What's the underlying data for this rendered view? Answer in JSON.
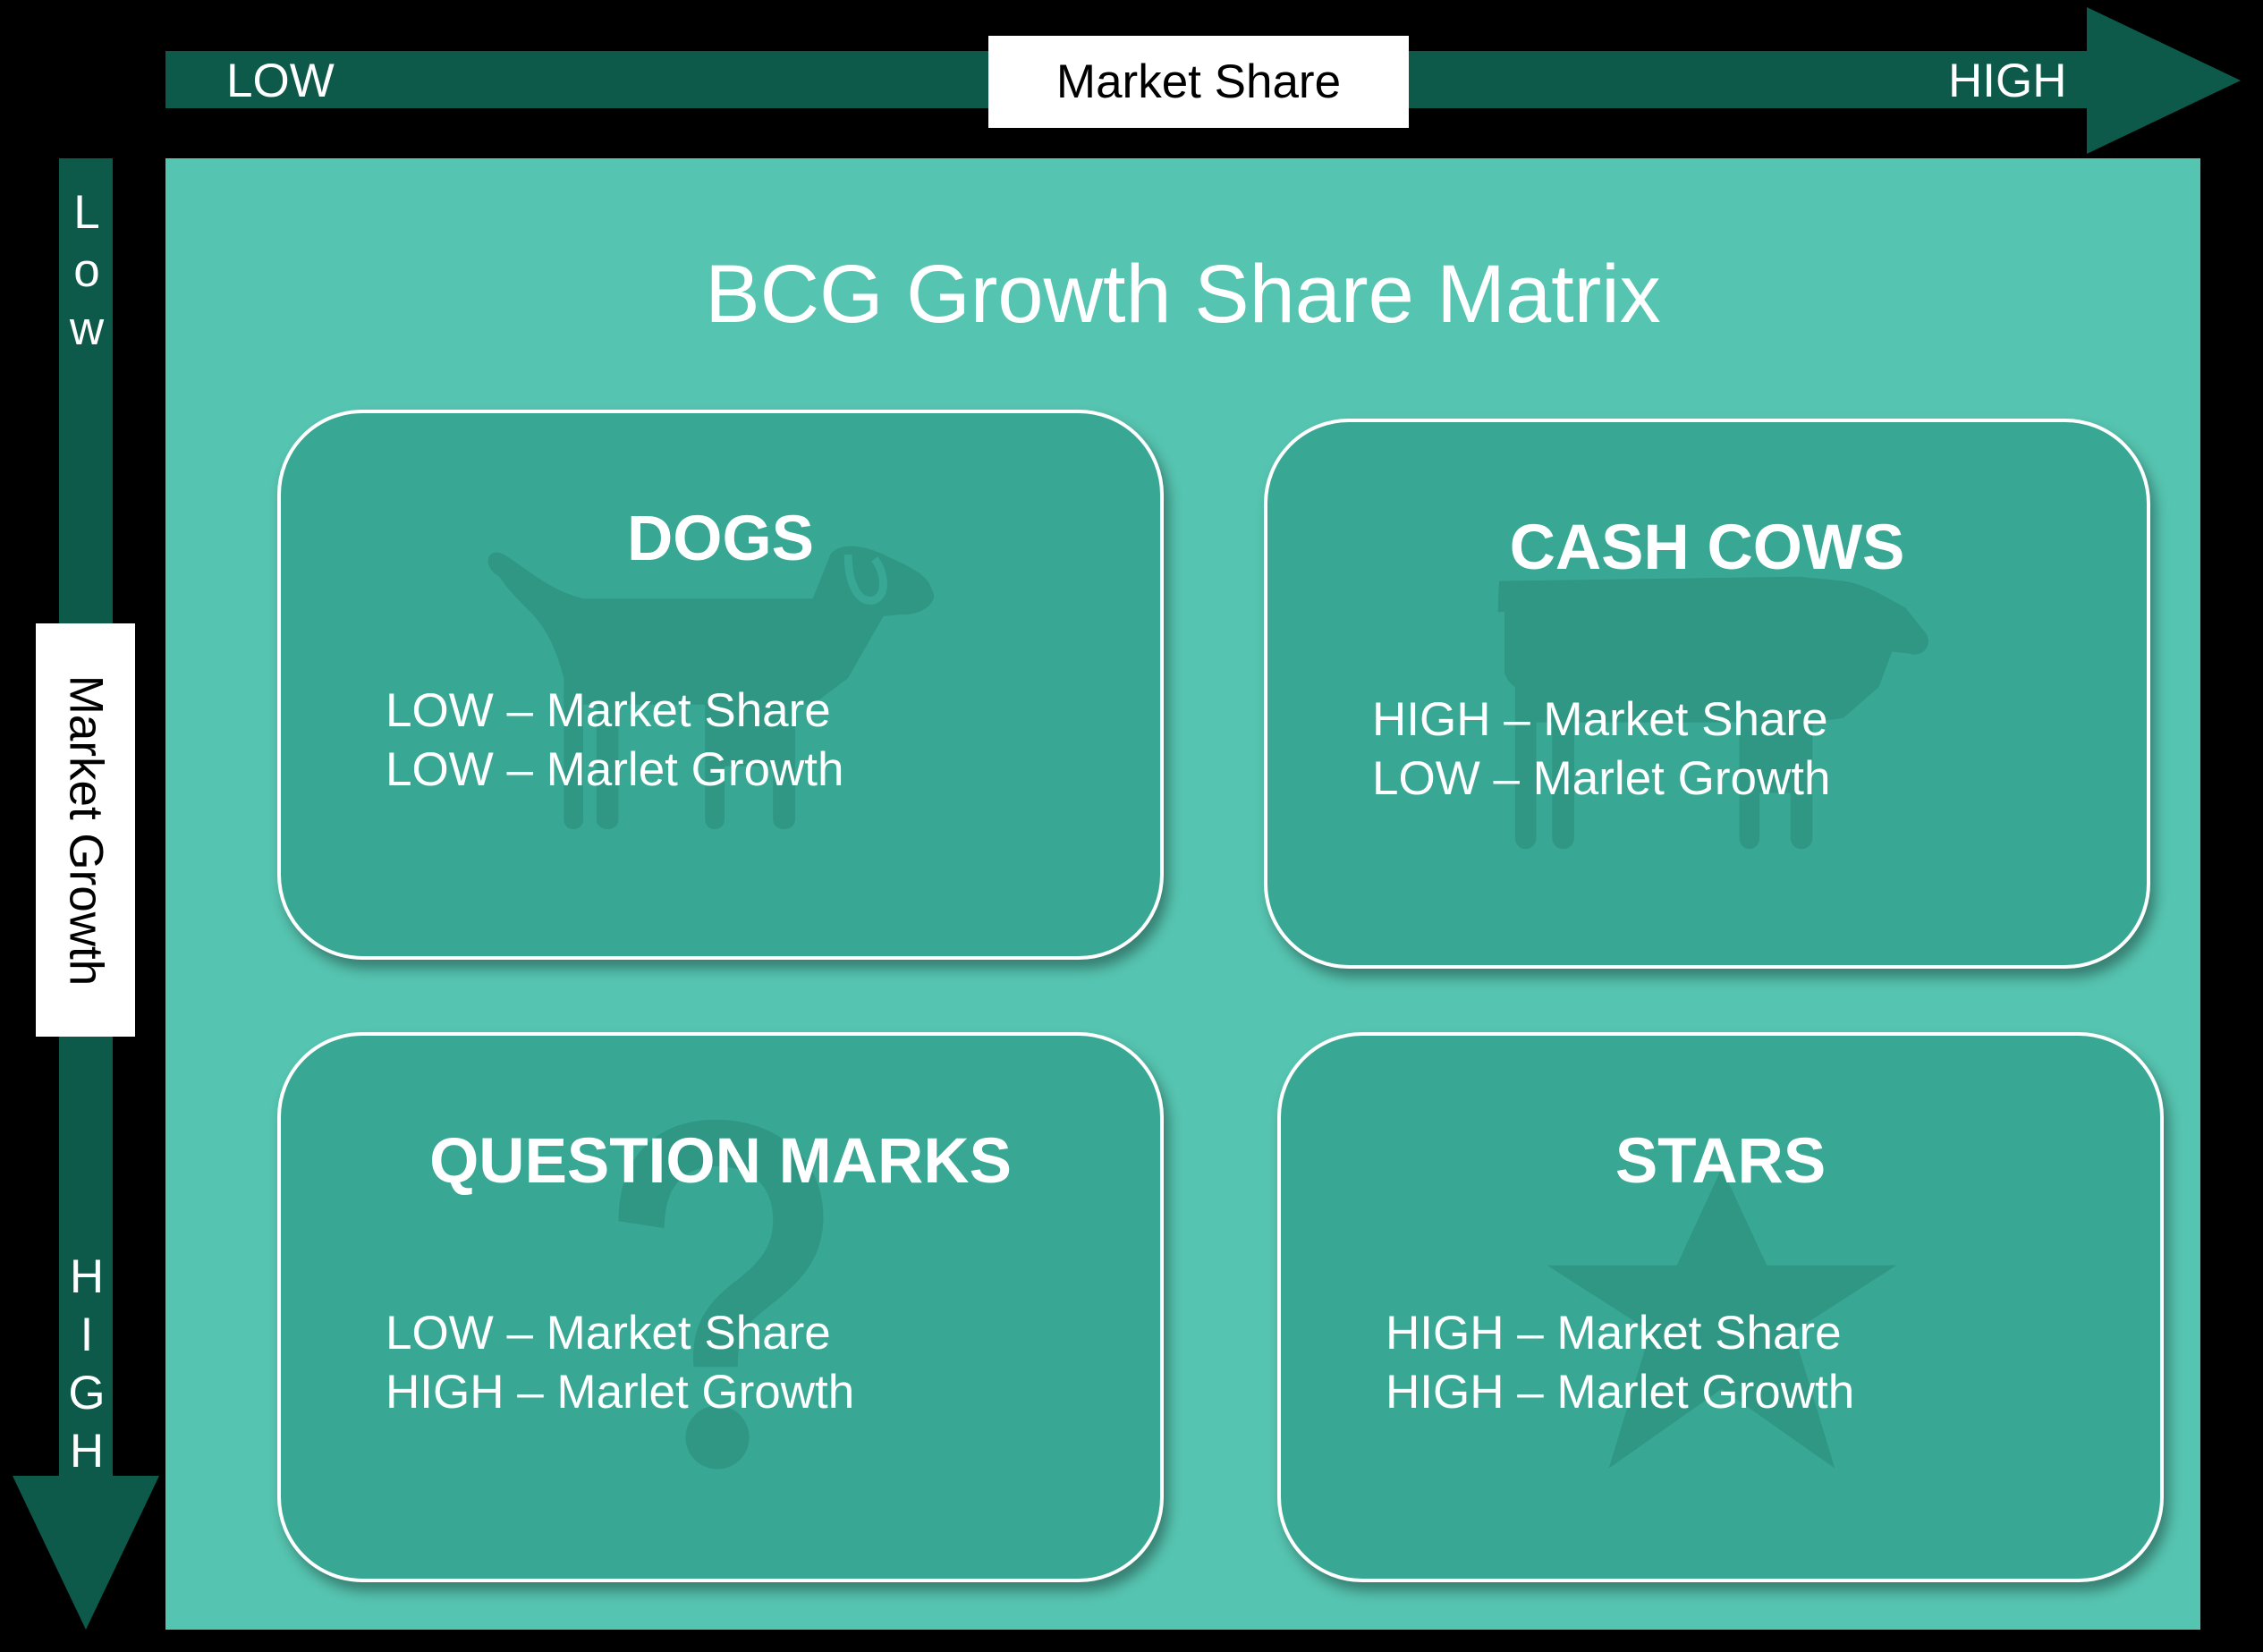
{
  "x_axis": {
    "label": "Market Share",
    "low": "LOW",
    "high": "HIGH"
  },
  "y_axis": {
    "label": "Market Growth",
    "low_letters": [
      "L",
      "o",
      "w"
    ],
    "high_letters": [
      "H",
      "I",
      "G",
      "H"
    ]
  },
  "title": "BCG Growth Share Matrix",
  "colors": {
    "arrow": "#0d5a4b",
    "matrix_bg": "#55c4b0",
    "quadrant_bg": "#38a894",
    "text": "#ffffff"
  },
  "quadrants": [
    {
      "key": "dogs",
      "title": "DOGS",
      "icon": "dog-icon",
      "lines": [
        "LOW – Market Share",
        "LOW – Marlet Growth"
      ]
    },
    {
      "key": "cashcows",
      "title": "CASH COWS",
      "icon": "cow-icon",
      "lines": [
        "HIGH – Market Share",
        "LOW – Marlet Growth"
      ]
    },
    {
      "key": "question",
      "title": "QUESTION MARKS",
      "icon": "question-mark-icon",
      "lines": [
        "LOW – Market Share",
        "HIGH – Marlet Growth"
      ]
    },
    {
      "key": "stars",
      "title": "STARS",
      "icon": "star-icon",
      "lines": [
        "HIGH – Market Share",
        "HIGH – Marlet Growth"
      ]
    }
  ]
}
